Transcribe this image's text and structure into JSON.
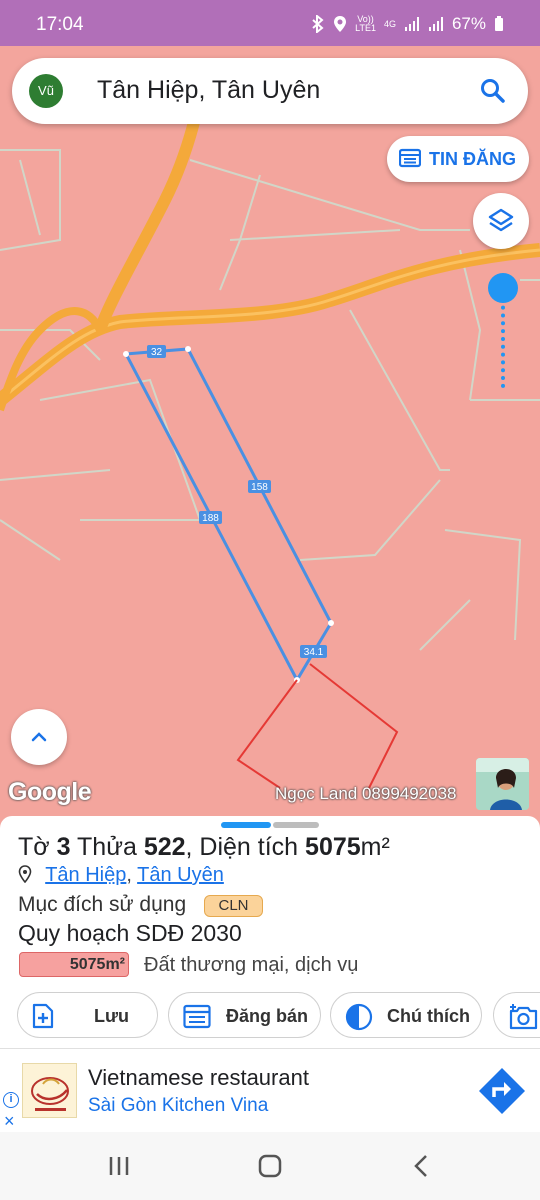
{
  "status_bar": {
    "time": "17:04",
    "volte_line1": "Vo))",
    "volte_line2": "LTE1",
    "network": "4G",
    "battery": "67%"
  },
  "search": {
    "avatar_text": "Vũ",
    "query": "Tân Hiệp, Tân Uyên",
    "icon": "search-icon"
  },
  "buttons": {
    "tin_dang": "TIN ĐĂNG"
  },
  "map": {
    "google_label": "Google",
    "watermark": "Ngọc Land 0899492038",
    "edge_labels": [
      "32",
      "158",
      "188",
      "34.1"
    ],
    "colors": {
      "land": "#f3a59d",
      "road": "#f4a93a",
      "parcel_outline": "#4a90e2",
      "neighbor_outline": "#e53935"
    }
  },
  "sheet": {
    "to_label": "Tờ",
    "to_value": "3",
    "thua_label": "Thửa",
    "thua_value": "522",
    "area_label": ", Diện tích",
    "area_value": "5075",
    "area_unit": "m²",
    "location_parts": [
      "Tân Hiệp",
      "Tân Uyên"
    ],
    "location_sep": ",",
    "purpose_label": "Mục đích sử dụng",
    "purpose_badge": "CLN",
    "plan_title": "Quy hoạch SDĐ 2030",
    "plan_area": "5075m²",
    "plan_desc": "Đất thương mại, dịch vụ"
  },
  "actions": [
    {
      "label": "Lưu",
      "icon": "save-file-icon"
    },
    {
      "label": "Đăng bán",
      "icon": "calendar-icon"
    },
    {
      "label": "Chú thích",
      "icon": "half-circle-icon"
    },
    {
      "label": "",
      "icon": "add-photo-icon"
    }
  ],
  "ad": {
    "title": "Vietnamese restaurant",
    "subtitle": "Sài Gòn Kitchen Vina",
    "info_icon": "i",
    "close_icon": "×"
  },
  "nav": {
    "recent": "|||",
    "back": "<"
  }
}
